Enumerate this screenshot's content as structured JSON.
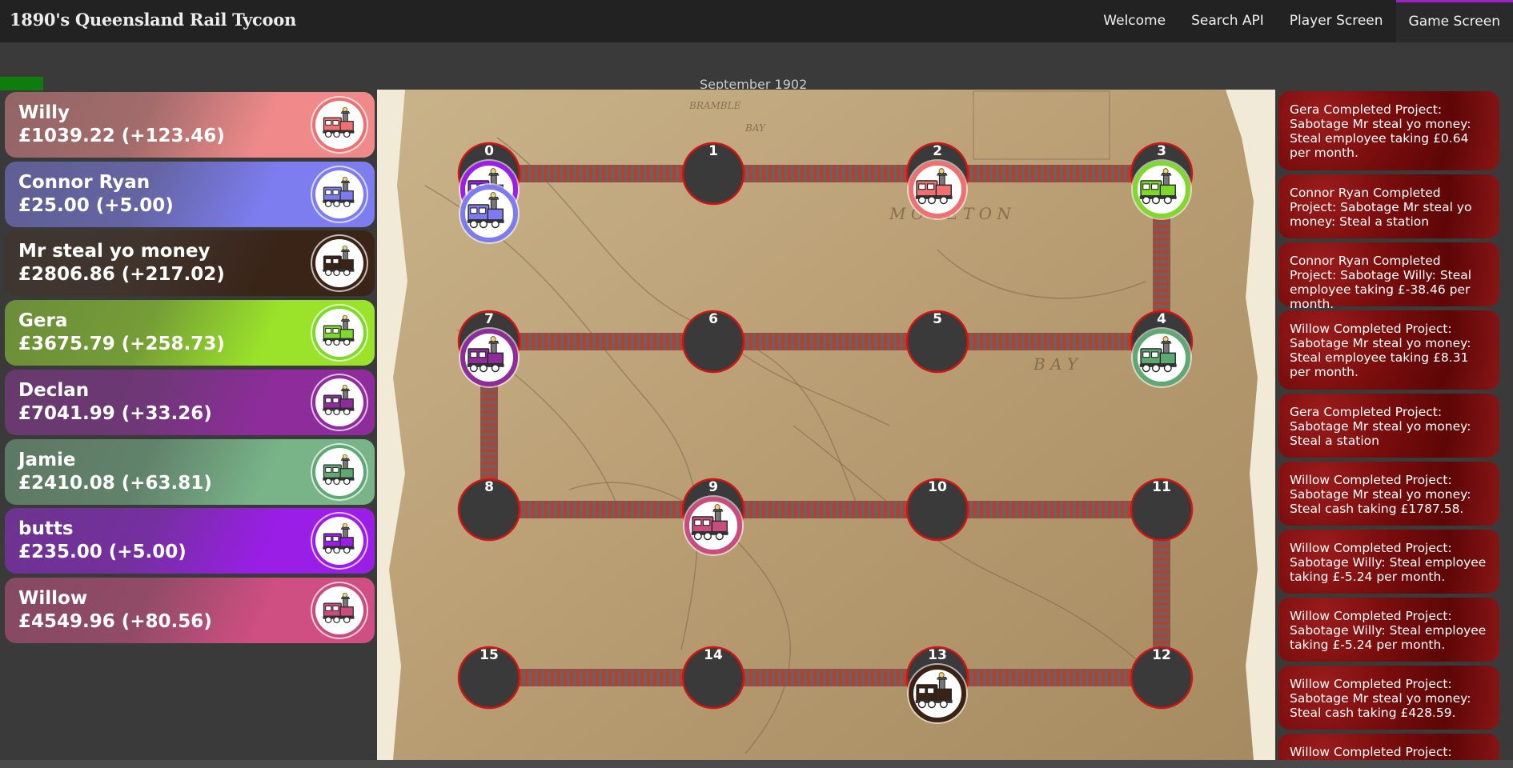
{
  "app": {
    "title": "1890's Queensland Rail Tycoon"
  },
  "nav": [
    {
      "label": "Welcome",
      "active": false
    },
    {
      "label": "Search API",
      "active": false
    },
    {
      "label": "Player Screen",
      "active": false
    },
    {
      "label": "Game Screen",
      "active": true
    }
  ],
  "game": {
    "date": "September 1902",
    "month_progress": 0.17
  },
  "players": [
    {
      "name": "Willy",
      "money": "£1039.22 (+123.46)",
      "color": "#f08a8a",
      "train_color": "#ee7070"
    },
    {
      "name": "Connor Ryan",
      "money": "£25.00 (+5.00)",
      "color": "#7d7df0",
      "train_color": "#7c7cf0"
    },
    {
      "name": "Mr steal yo money",
      "money": "£2806.86 (+217.02)",
      "color": "#3a2418",
      "train_color": "#3b2214"
    },
    {
      "name": "Gera",
      "money": "£3675.79 (+258.73)",
      "color": "#9ae32a",
      "train_color": "#7fd82c"
    },
    {
      "name": "Declan",
      "money": "£7041.99 (+33.26)",
      "color": "#8e2c9c",
      "train_color": "#8e2c9c"
    },
    {
      "name": "Jamie",
      "money": "£2410.08 (+63.81)",
      "color": "#78b488",
      "train_color": "#5fa873"
    },
    {
      "name": "butts",
      "money": "£235.00 (+5.00)",
      "color": "#9a1ee6",
      "train_color": "#9a1ee6"
    },
    {
      "name": "Willow",
      "money": "£4549.96 (+80.56)",
      "color": "#d04f82",
      "train_color": "#c94c7e"
    }
  ],
  "board": {
    "nodes": [
      {
        "id": "0"
      },
      {
        "id": "1"
      },
      {
        "id": "2"
      },
      {
        "id": "3"
      },
      {
        "id": "7"
      },
      {
        "id": "6"
      },
      {
        "id": "5"
      },
      {
        "id": "4"
      },
      {
        "id": "8"
      },
      {
        "id": "9"
      },
      {
        "id": "10"
      },
      {
        "id": "11"
      },
      {
        "id": "15"
      },
      {
        "id": "14"
      },
      {
        "id": "13"
      },
      {
        "id": "12"
      }
    ]
  },
  "feed": [
    "Gera Completed Project: Sabotage Mr steal yo money: Steal employee taking £0.64 per month.",
    "Connor Ryan Completed Project: Sabotage Mr steal yo money: Steal a station",
    "Connor Ryan Completed Project: Sabotage Willy: Steal employee taking £-38.46 per month.",
    "Willow Completed Project: Sabotage Mr steal yo money: Steal employee taking £8.31 per month.",
    "Gera Completed Project: Sabotage Mr steal yo money: Steal a station",
    "Willow Completed Project: Sabotage Mr steal yo money: Steal cash taking £1787.58.",
    "Willow Completed Project: Sabotage Willy: Steal employee taking £-5.24 per month.",
    "Willow Completed Project: Sabotage Willy: Steal employee taking £-5.24 per month.",
    "Willow Completed Project: Sabotage Mr steal yo money: Steal cash taking £428.59.",
    "Willow Completed Project:"
  ]
}
